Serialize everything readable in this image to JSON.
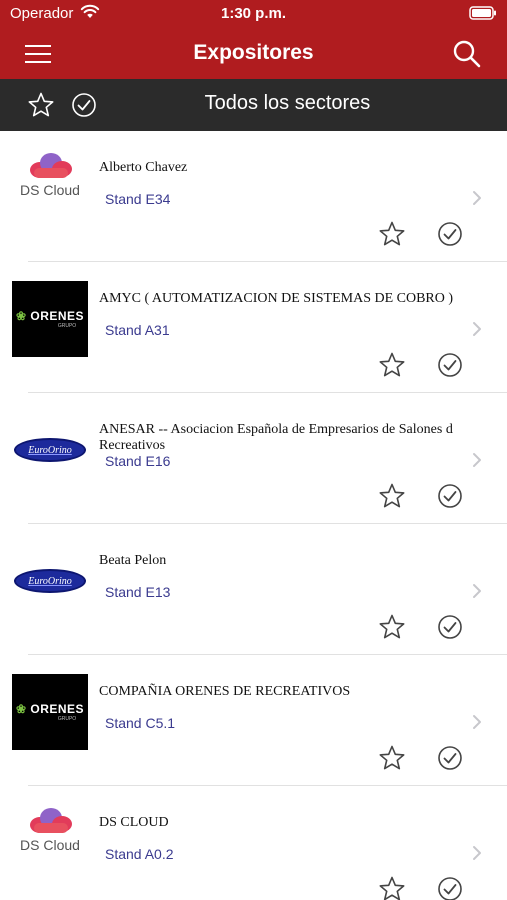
{
  "status_bar": {
    "carrier": "Operador",
    "time": "1:30 p.m."
  },
  "nav": {
    "title": "Expositores"
  },
  "filter": {
    "sector": "Todos los sectores"
  },
  "exhibitors": [
    {
      "name": "Alberto Chavez",
      "stand": "Stand E34",
      "logo": "ds-cloud",
      "logo_text": "DS Cloud"
    },
    {
      "name": "AMYC ( AUTOMATIZACION DE SISTEMAS DE COBRO )",
      "stand": "Stand A31",
      "logo": "orenes",
      "logo_text": "ORENES",
      "logo_sub": "GRUPO"
    },
    {
      "name": "ANESAR -- Asociacion Española de Empresarios de Salones d Recreativos",
      "stand": "Stand E16",
      "logo": "euroorino",
      "logo_text": "EuroOrino"
    },
    {
      "name": "Beata Pelon",
      "stand": "Stand E13",
      "logo": "euroorino",
      "logo_text": "EuroOrino"
    },
    {
      "name": "COMPAÑIA ORENES DE RECREATIVOS",
      "stand": "Stand C5.1",
      "logo": "orenes",
      "logo_text": "ORENES",
      "logo_sub": "GRUPO"
    },
    {
      "name": "DS CLOUD",
      "stand": "Stand A0.2",
      "logo": "ds-cloud",
      "logo_text": "DS Cloud"
    }
  ],
  "icons": {
    "menu": "hamburger-icon",
    "search": "search-icon",
    "favorite": "star-outline-icon",
    "visited": "check-circle-icon",
    "disclosure": "chevron-right-icon"
  },
  "colors": {
    "header": "#b01c1f",
    "filter_bar": "#2b2b2b",
    "stand_text": "#3b3b8f",
    "separator": "#e1e1e1"
  }
}
